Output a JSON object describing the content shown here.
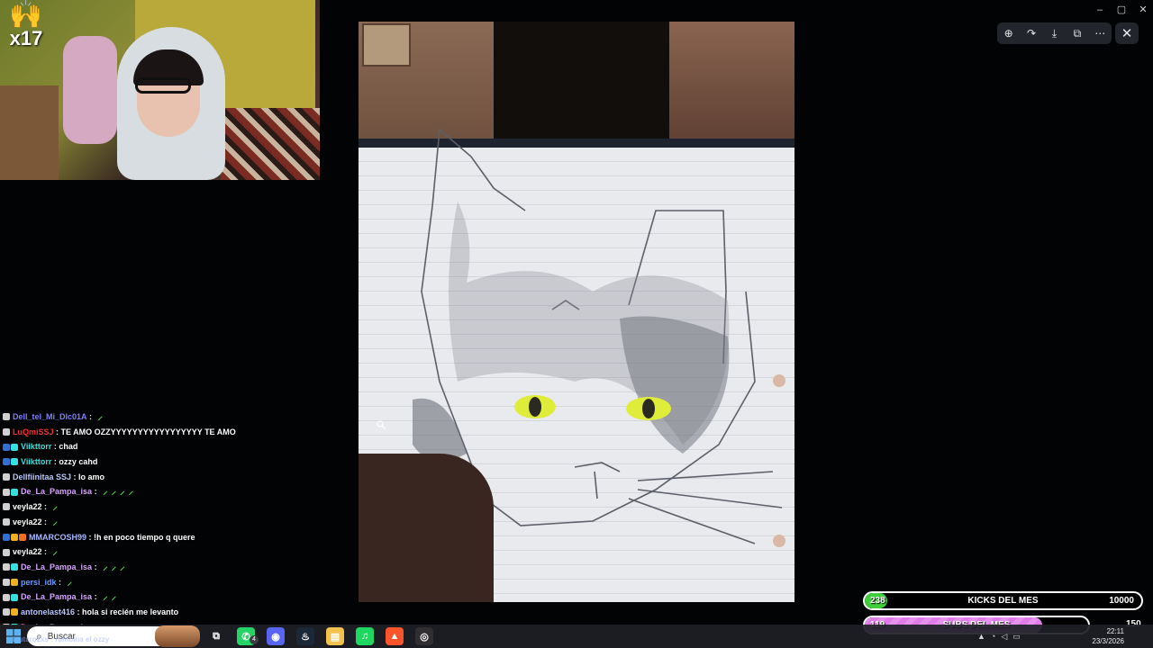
{
  "streak": {
    "count": "x17",
    "icon": "praying-hands-icon"
  },
  "viewer": {
    "toolbar": [
      {
        "name": "zoom-in-icon",
        "glyph": "⊕"
      },
      {
        "name": "share-icon",
        "glyph": "↷"
      },
      {
        "name": "download-icon",
        "glyph": "⤓"
      },
      {
        "name": "open-external-icon",
        "glyph": "⧉"
      },
      {
        "name": "more-options-icon",
        "glyph": "⋯"
      }
    ],
    "close_glyph": "✕",
    "window_controls": [
      "–",
      "▢",
      "✕"
    ]
  },
  "chat": [
    {
      "user": "Dell_tel_Mi_Dlc01A",
      "color": "#7f7fff",
      "msg": "",
      "badges": [
        "#d0d0d0"
      ],
      "emotes": 1
    },
    {
      "user": "LuQmiSSJ",
      "color": "#ff2b2b",
      "msg": "TE AMO OZZYYYYYYYYYYYYYYYYY TE AMO",
      "badges": [
        "#d0d0d0"
      ],
      "emotes": 0
    },
    {
      "user": "Viikttorr",
      "color": "#35e0e0",
      "msg": "chad",
      "badges": [
        "#2f6fd6",
        "#35e0e0"
      ],
      "emotes": 0
    },
    {
      "user": "Viikttorr",
      "color": "#35e0e0",
      "msg": "ozzy cahd",
      "badges": [
        "#2f6fd6",
        "#35e0e0"
      ],
      "emotes": 0
    },
    {
      "user": "Dellfiinitaa SSJ",
      "color": "#b9c8ff",
      "msg": "lo amo",
      "badges": [
        "#d0d0d0"
      ],
      "emotes": 0
    },
    {
      "user": "De_La_Pampa_isa",
      "color": "#d9a5ff",
      "msg": "",
      "badges": [
        "#d0d0d0",
        "#35e0e0"
      ],
      "emotes": 4
    },
    {
      "user": "veyla22",
      "color": "#ffffff",
      "msg": "",
      "badges": [
        "#d0d0d0"
      ],
      "emotes": 1
    },
    {
      "user": "veyla22",
      "color": "#ffffff",
      "msg": "",
      "badges": [
        "#d0d0d0"
      ],
      "emotes": 1
    },
    {
      "user": "MMARCOSH99",
      "color": "#a8b8ff",
      "msg": "!h en poco tiempo q quere",
      "badges": [
        "#2f6fd6",
        "#f0b020",
        "#f07020"
      ],
      "emotes": 0
    },
    {
      "user": "veyla22",
      "color": "#ffffff",
      "msg": "",
      "badges": [
        "#d0d0d0"
      ],
      "emotes": 1
    },
    {
      "user": "De_La_Pampa_isa",
      "color": "#d9a5ff",
      "msg": "",
      "badges": [
        "#d0d0d0",
        "#35e0e0"
      ],
      "emotes": 3
    },
    {
      "user": "persi_idk",
      "color": "#6a9bff",
      "msg": "",
      "badges": [
        "#d0d0d0",
        "#f0b020"
      ],
      "emotes": 1
    },
    {
      "user": "De_La_Pampa_isa",
      "color": "#d9a5ff",
      "msg": "",
      "badges": [
        "#d0d0d0",
        "#35e0e0"
      ],
      "emotes": 2
    },
    {
      "user": "antonelast416",
      "color": "#b9c8ff",
      "msg": "hola si recién me levanto",
      "badges": [
        "#d0d0d0",
        "#f0b020"
      ],
      "emotes": 0
    },
    {
      "user": "De_La_Pampa_isa",
      "color": "#d9a5ff",
      "msg": "",
      "badges": [
        "#d0d0d0",
        "#35e0e0"
      ],
      "emotes": 1
    }
  ],
  "goals": {
    "kicks": {
      "current": "238",
      "title": "KICKS DEL MES",
      "goal": "10000",
      "fraction": 0.024,
      "color": "#3fcf3a"
    },
    "subs": {
      "current": "119",
      "title": "SUBS DEL MES",
      "goal": "150",
      "fraction": 0.793,
      "color": "#e07bea"
    }
  },
  "taskbar": {
    "search_placeholder": "Buscar",
    "ticker": "lautaro2xs : rumbina el ozzy",
    "apps": [
      {
        "name": "task-view-icon",
        "glyph": "⧉",
        "bg": "transparent"
      },
      {
        "name": "whatsapp-icon",
        "glyph": "✆",
        "bg": "#25d366",
        "badge": "4"
      },
      {
        "name": "discord-icon",
        "glyph": "◉",
        "bg": "#5865f2"
      },
      {
        "name": "steam-icon",
        "glyph": "♨",
        "bg": "#1b2838"
      },
      {
        "name": "file-explorer-icon",
        "glyph": "▤",
        "bg": "#f2c14e"
      },
      {
        "name": "spotify-icon",
        "glyph": "♫",
        "bg": "#1ed760"
      },
      {
        "name": "brave-icon",
        "glyph": "▲",
        "bg": "#fb542b"
      },
      {
        "name": "obs-icon",
        "glyph": "◎",
        "bg": "#302e31"
      }
    ],
    "time": "22:11",
    "date": "23/3/2026",
    "notifications": "150"
  }
}
